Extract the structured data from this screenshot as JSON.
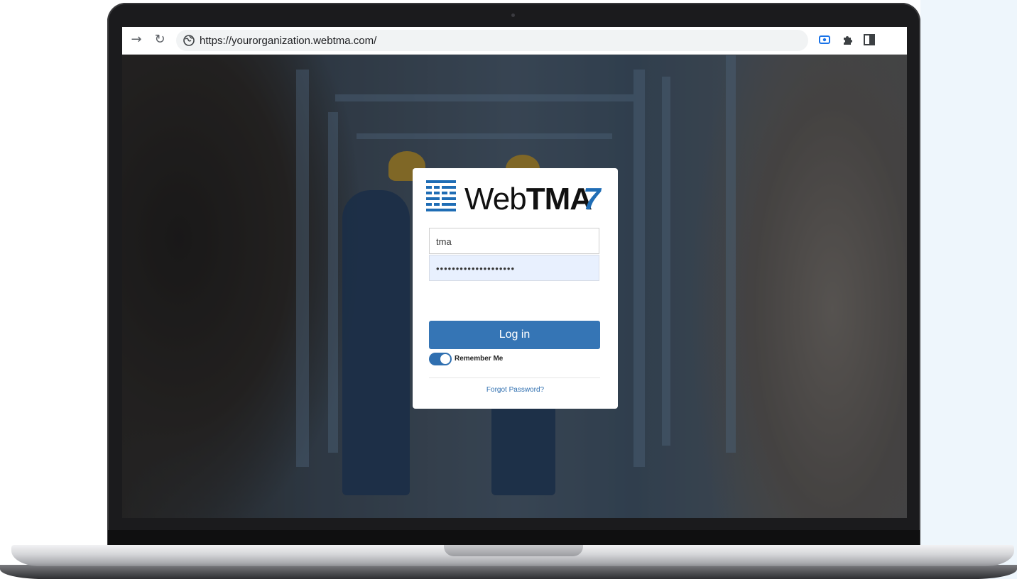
{
  "browser": {
    "url": "https://yourorganization.webtma.com/",
    "nav_icons": [
      "forward-arrow-icon",
      "reload-icon"
    ],
    "toolbar_icons": [
      "screen-capture-icon",
      "extensions-puzzle-icon",
      "side-panel-icon"
    ]
  },
  "login": {
    "logo": {
      "text_regular": "Web",
      "text_bold": "TMA",
      "version": "7"
    },
    "username_value": "tma",
    "password_mask": "••••••••••••••••••••",
    "login_button_label": "Log in",
    "remember_me_label": "Remember Me",
    "remember_me_on": true,
    "forgot_password_label": "Forgot Password?"
  },
  "colors": {
    "primary_blue": "#3575b5",
    "logo_blue": "#1f6db5",
    "autofill_bg": "#e8f0fe"
  }
}
